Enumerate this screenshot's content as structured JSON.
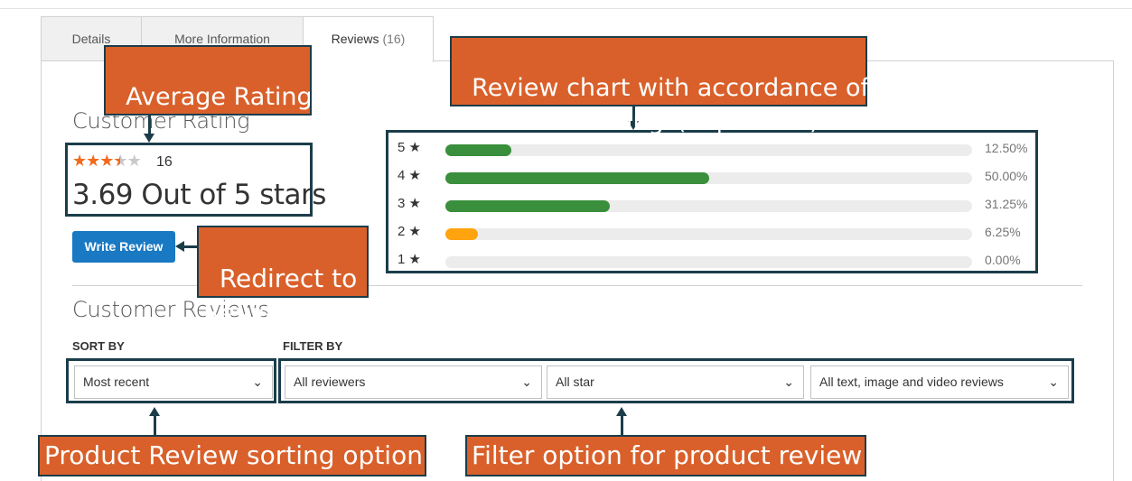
{
  "tabs": [
    {
      "label": "Details"
    },
    {
      "label": "More Information"
    },
    {
      "label": "Reviews",
      "count": "(16)"
    }
  ],
  "rating": {
    "title": "Customer Rating",
    "value": 3.69,
    "review_total": "16",
    "average_text": "3.69 Out of 5 stars",
    "write_review_label": "Write Review"
  },
  "breakdown": [
    {
      "label": "5 ★",
      "percent": 12.5,
      "percent_text": "12.50%",
      "color": "#3a8f3c"
    },
    {
      "label": "4 ★",
      "percent": 50.0,
      "percent_text": "50.00%",
      "color": "#3a8f3c"
    },
    {
      "label": "3 ★",
      "percent": 31.25,
      "percent_text": "31.25%",
      "color": "#3a8f3c"
    },
    {
      "label": "2 ★",
      "percent": 6.25,
      "percent_text": "6.25%",
      "color": "#ffa30f"
    },
    {
      "label": "1 ★",
      "percent": 0.0,
      "percent_text": "0.00%",
      "color": "#3a8f3c"
    }
  ],
  "reviews": {
    "title": "Customer Reviews",
    "sort_label": "SORT BY",
    "filter_label": "FILTER BY",
    "sort_value": "Most recent",
    "filter_reviewers": "All reviewers",
    "filter_star": "All star",
    "filter_media": "All text, image and video reviews"
  },
  "annotations": {
    "avg": "Average Rating and\ntotal review",
    "chart": "Review chart with accordance of\ncustomers ratings(in percent)",
    "redirect": "Redirect to\nReview form",
    "sorting": "Product Review sorting option",
    "filter": "Filter option for product review"
  },
  "colors": {
    "accent": "#1979c3",
    "star": "#f26a1b",
    "callout": "#d9602a",
    "frame": "#1b3d4a"
  }
}
